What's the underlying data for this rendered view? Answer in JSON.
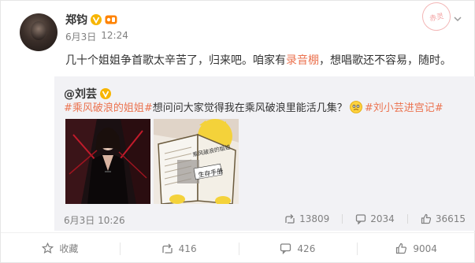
{
  "post": {
    "author": "郑钧",
    "date": "6月3日",
    "time": "12:24",
    "text_before": "几十个姐姐争首歌太辛苦了，归来吧。咱家有",
    "text_highlight": "录音棚",
    "text_after": "，想唱歌还不容易，随时。"
  },
  "repost": {
    "user": "@刘芸",
    "tag1": "#乘风破浪的姐姐#",
    "text": " 想问问大家觉得我在乘风破浪里能活几集？",
    "tag2": "#刘小芸进宫记#",
    "book_title": "乘风破浪的姐姐",
    "book_subtitle": "生存手册",
    "date": "6月3日",
    "time": "10:26",
    "reposts": "13809",
    "comments": "2034",
    "likes": "36615"
  },
  "stamp_text": "赤灵",
  "actions": {
    "favorite": "收藏",
    "repost": "416",
    "comment": "426",
    "like": "9004"
  },
  "colors": {
    "accent": "#eb7350",
    "muted": "#808080",
    "repost_bg": "#f2f2f5"
  }
}
